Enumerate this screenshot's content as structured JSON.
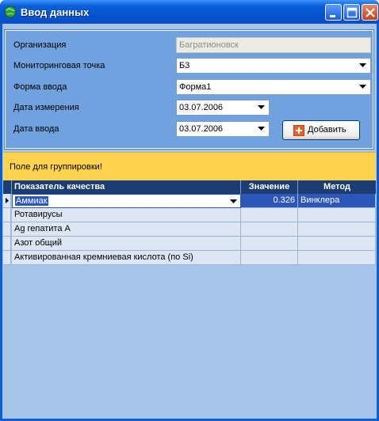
{
  "window": {
    "title": "Ввод данных",
    "accent": "#0a5fd8"
  },
  "form": {
    "organization_label": "Организация",
    "organization_value": "Багратионовск",
    "monitoring_point_label": "Мониторинговая точка",
    "monitoring_point_value": "Б3",
    "input_form_label": "Форма ввода",
    "input_form_value": "Форма1",
    "measurement_date_label": "Дата измерения",
    "measurement_date_value": "03.07.2006",
    "input_date_label": "Дата ввода",
    "input_date_value": "03.07.2006",
    "add_button_label": "Добавить"
  },
  "grouping": {
    "text": "Поле для группировки!",
    "color": "#ffd34e"
  },
  "grid": {
    "columns": [
      "Показатель качества",
      "Значение",
      "Метод"
    ],
    "rows": [
      {
        "name": "Аммиак",
        "value": "0.326",
        "method": "Винклера",
        "selected": true
      },
      {
        "name": "Ротавирусы",
        "value": "",
        "method": ""
      },
      {
        "name": "Ag гепатита А",
        "value": "",
        "method": ""
      },
      {
        "name": "Азот общий",
        "value": "",
        "method": ""
      },
      {
        "name": "Активированная кремниевая кислота (по Si)",
        "value": "",
        "method": ""
      }
    ]
  }
}
